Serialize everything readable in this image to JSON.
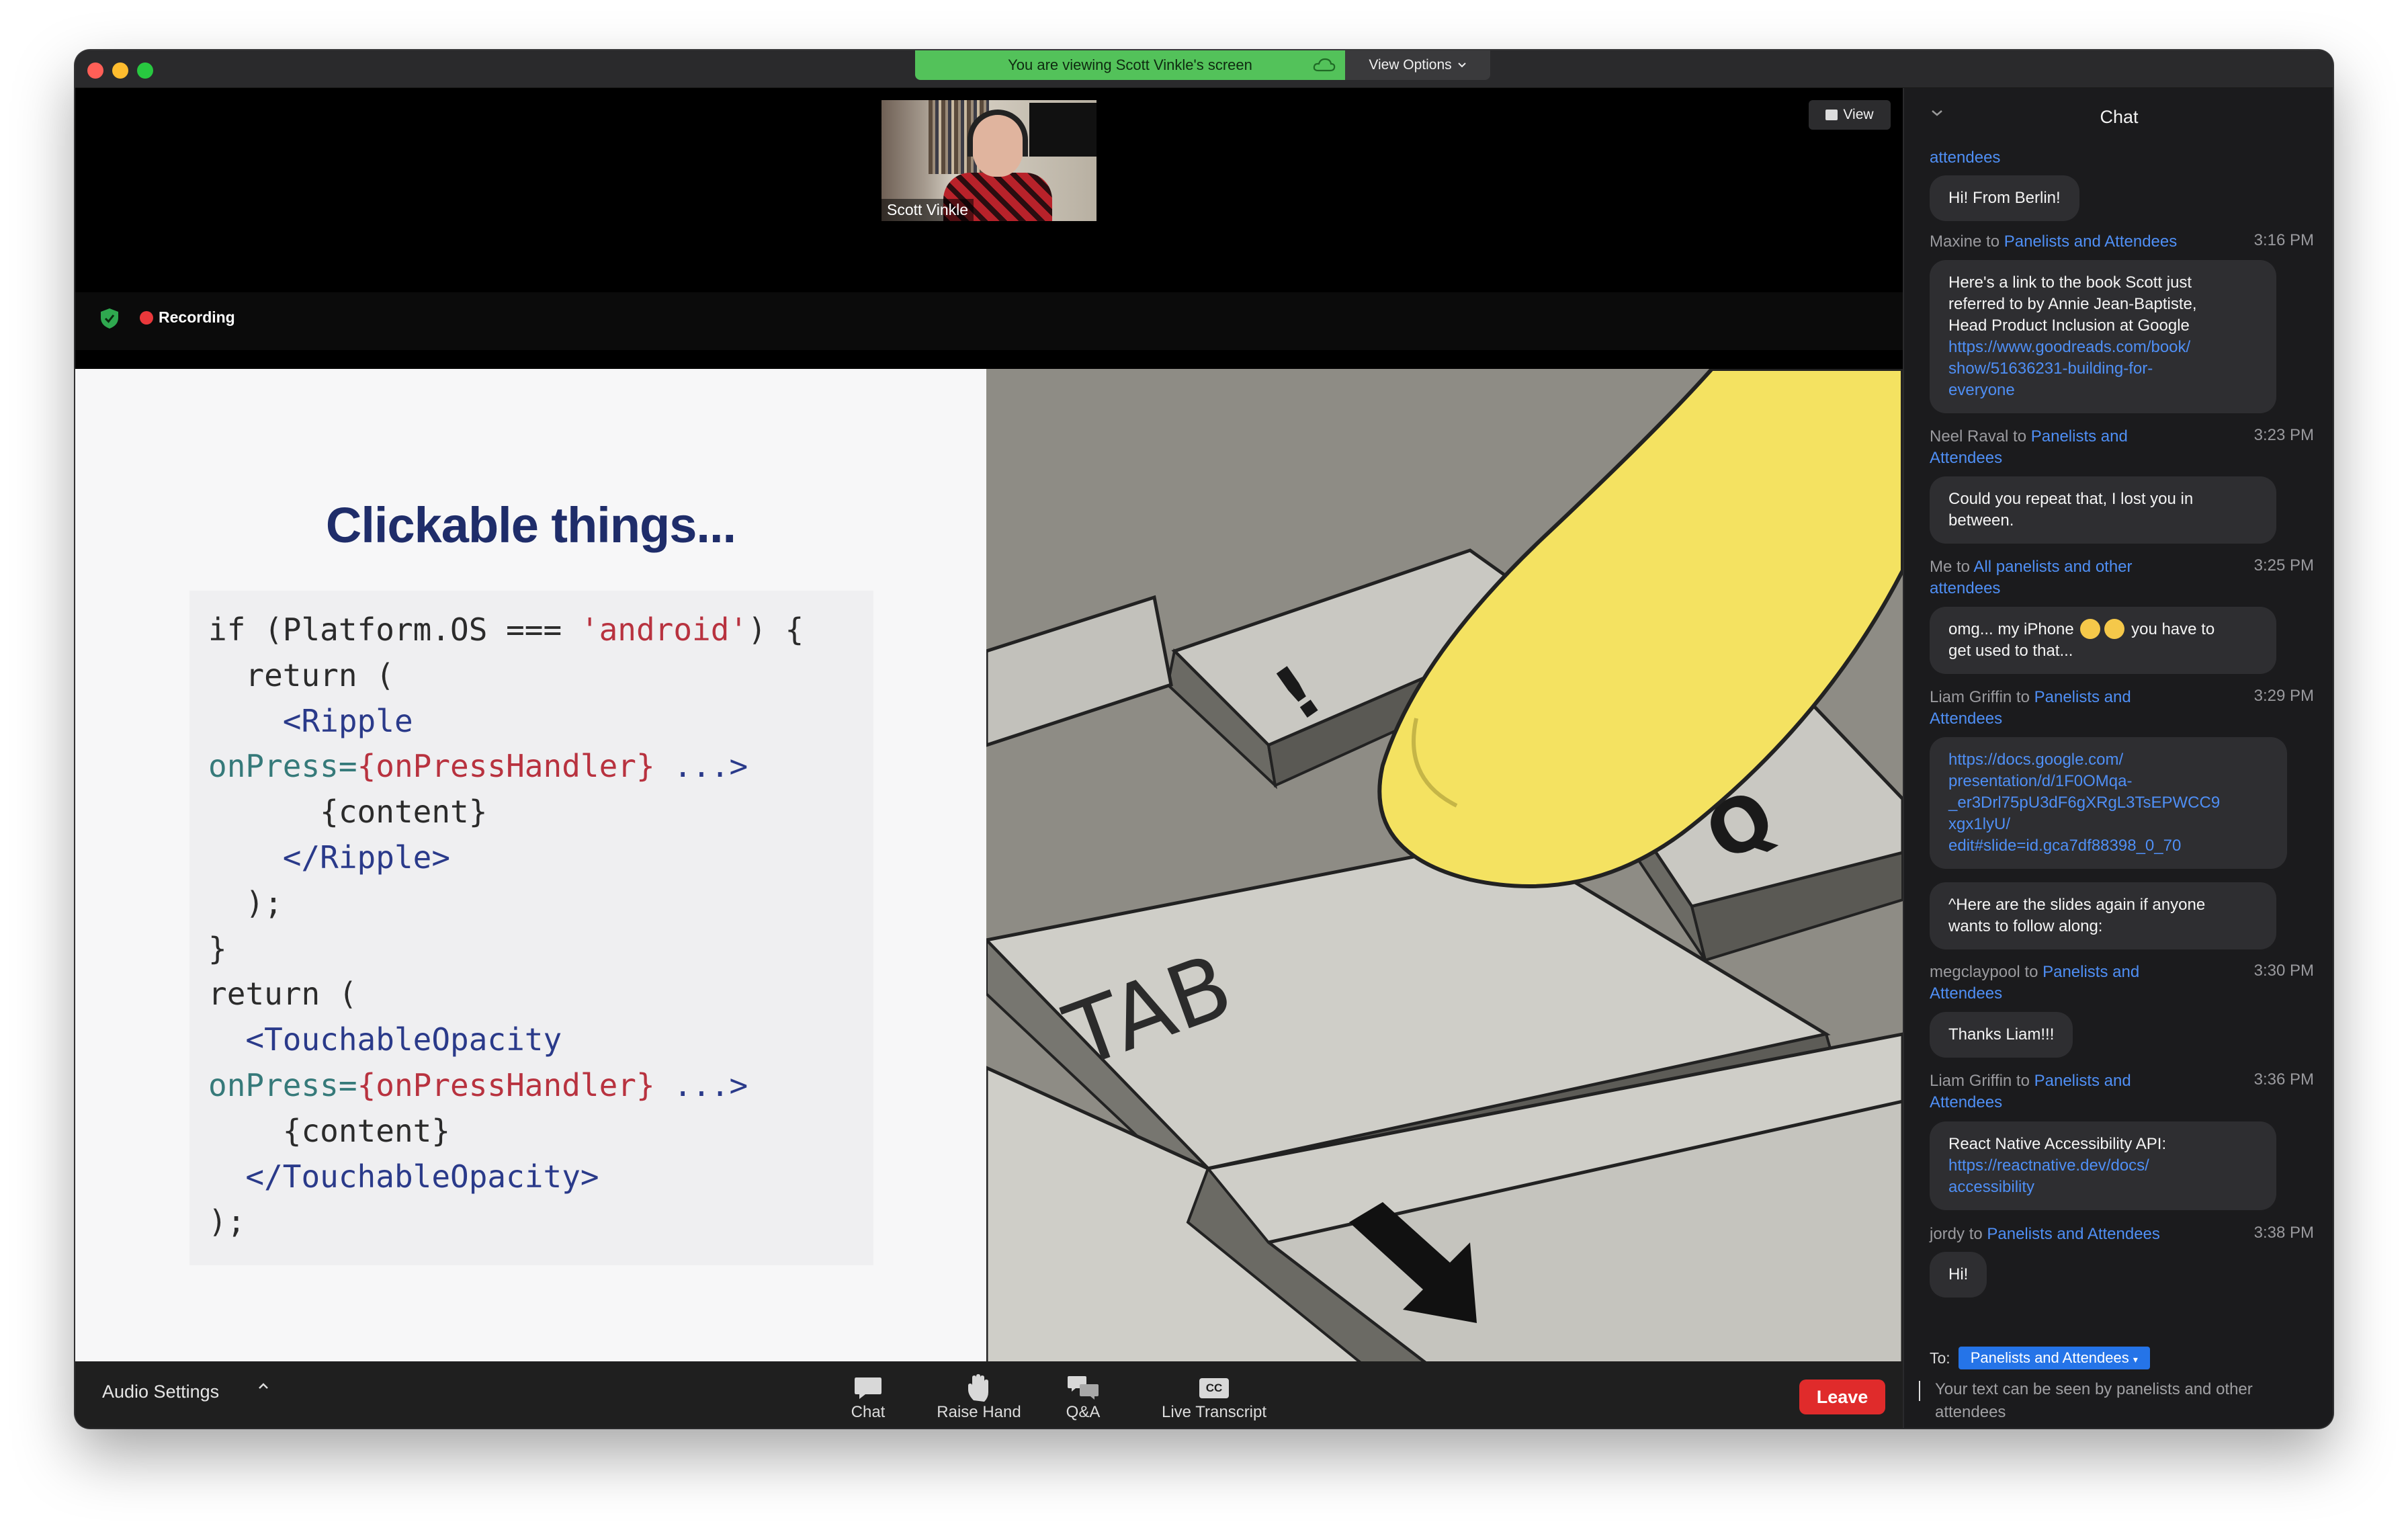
{
  "banner": {
    "sharing_text": "You are viewing Scott Vinkle's screen",
    "view_options": "View Options"
  },
  "video": {
    "thumbnail_name": "Scott Vinkle",
    "view_button": "View",
    "recording_label": "Recording"
  },
  "slide": {
    "title": "Clickable things...",
    "code_lines": [
      "if (Platform.OS === 'android') {",
      "  return (",
      "    <Ripple",
      "onPress={onPressHandler} ...>",
      "      {content}",
      "    </Ripple>",
      "  );",
      "}",
      "return (",
      "  <TouchableOpacity",
      "onPress={onPressHandler} ...>",
      "    {content}",
      "  </TouchableOpacity>",
      ");"
    ],
    "image_labels": {
      "key1": "!",
      "key2": "Q",
      "key3": "TAB"
    }
  },
  "controls": {
    "audio_settings": "Audio Settings",
    "chat": "Chat",
    "raise_hand": "Raise Hand",
    "qa": "Q&A",
    "live_transcript": "Live Transcript",
    "cc_badge": "CC",
    "leave": "Leave"
  },
  "chat": {
    "title": "Chat",
    "messages": [
      {
        "sender": "",
        "to": "attendees",
        "time": "",
        "text": [
          "Hi! From Berlin!"
        ]
      },
      {
        "sender": "Maxine to ",
        "to": "Panelists and Attendees",
        "time": "3:16 PM",
        "text": [
          "Here's a link to the book Scott just",
          "referred to by Annie Jean-Baptiste,",
          "Head Product Inclusion at Google"
        ],
        "links": [
          "https://www.goodreads.com/book/",
          "show/51636231-building-for-",
          "everyone"
        ]
      },
      {
        "sender": "Neel Raval to ",
        "to": "Panelists and",
        "to2": "Attendees",
        "time": "3:23 PM",
        "text": [
          "Could you repeat that, I lost you in",
          "between."
        ]
      },
      {
        "sender": "Me to ",
        "to": "All panelists and other",
        "to2": "attendees",
        "time": "3:25 PM",
        "text_a": "omg... my iPhone",
        "text_b": "you have to",
        "text_c": "get used to that..."
      },
      {
        "sender": "Liam Griffin to ",
        "to": "Panelists and",
        "to2": "Attendees",
        "time": "3:29 PM",
        "links": [
          "https://docs.google.com/",
          "presentation/d/1F0OMqa-",
          "_er3Drl75pU3dF6gXRgL3TsEPWCC9",
          "xgx1lyU/",
          "edit#slide=id.gca7df88398_0_70"
        ],
        "text2": [
          "^Here are the slides again if anyone",
          "wants to follow along:"
        ]
      },
      {
        "sender": "megclaypool to ",
        "to": "Panelists and",
        "to2": "Attendees",
        "time": "3:30 PM",
        "text": [
          "Thanks Liam!!!"
        ]
      },
      {
        "sender": "Liam Griffin to ",
        "to": "Panelists and",
        "to2": "Attendees",
        "time": "3:36 PM",
        "text": [
          "React Native Accessibility API:"
        ],
        "links": [
          "https://reactnative.dev/docs/",
          "accessibility"
        ]
      },
      {
        "sender": "jordy to ",
        "to": "Panelists and Attendees",
        "time": "3:38 PM",
        "text": [
          "Hi!"
        ]
      }
    ],
    "to_label": "To:",
    "to_target": "Panelists and Attendees",
    "input_placeholder": "Your text can be seen by panelists and other attendees"
  },
  "colors": {
    "banner_green": "#53c25a",
    "link_blue": "#4f8ff5",
    "leave_red": "#e02b2b",
    "slide_title": "#1f2d6a",
    "recording_red": "#e9383b"
  }
}
